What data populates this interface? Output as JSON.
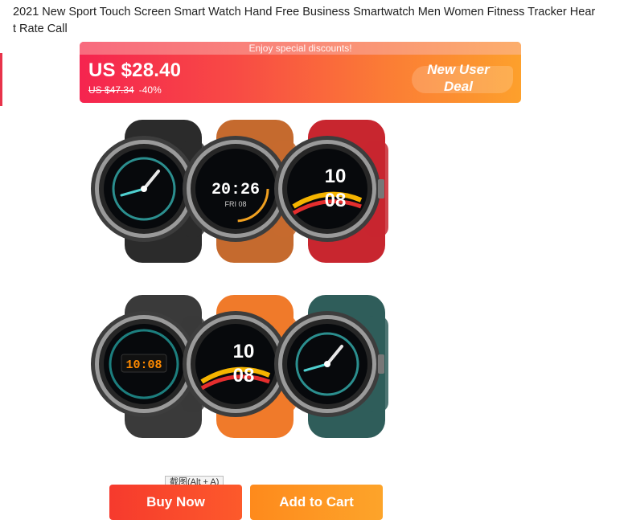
{
  "product": {
    "title": "2021 New Sport Touch Screen Smart Watch Hand Free Business Smartwatch Men Women Fitness Tracker Heart Rate Call"
  },
  "deal": {
    "header": "Enjoy special discounts!",
    "price": "US $28.40",
    "original_price": "US $47.34",
    "discount": "-40%",
    "badge_line1": "New User",
    "badge_line2": "Deal"
  },
  "watches": [
    {
      "band_color": "#2b2b2b",
      "screen": "analog",
      "time": "",
      "date": ""
    },
    {
      "band_color": "#c56a2e",
      "screen": "digital",
      "time": "20:26",
      "date": "FRI 08"
    },
    {
      "band_color": "#c8262f",
      "screen": "sport",
      "time": "10",
      "date": "08"
    },
    {
      "band_color": "#3a3a3a",
      "screen": "orange-digital",
      "time": "10:08",
      "date": ""
    },
    {
      "band_color": "#f07a2a",
      "screen": "sport",
      "time": "10",
      "date": "08"
    },
    {
      "band_color": "#2f5d5a",
      "screen": "analog",
      "time": "",
      "date": ""
    }
  ],
  "tooltip": {
    "text": "截图(Alt + A)"
  },
  "actions": {
    "buy_now": "Buy Now",
    "add_to_cart": "Add to Cart"
  },
  "colors": {
    "deal_start": "#f5244f",
    "deal_end": "#fda02c",
    "buy_now": "#f63a2d",
    "add_to_cart": "#fe8a1c"
  }
}
